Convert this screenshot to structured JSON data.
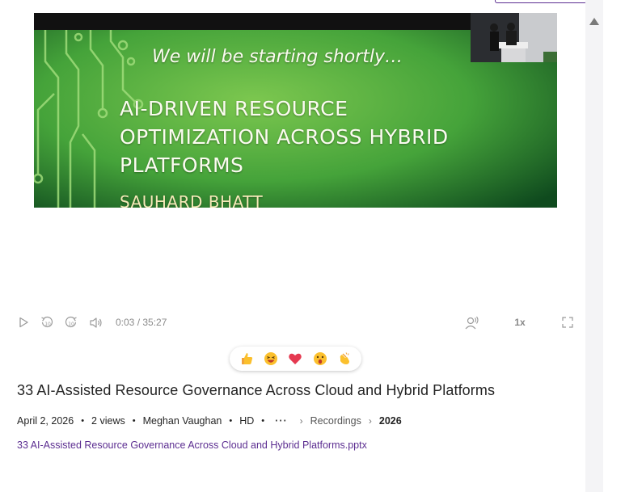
{
  "video": {
    "slide_starting": "We will be starting shortly…",
    "slide_title_lines": [
      "AI-DRIVEN RESOURCE",
      "OPTIMIZATION ACROSS HYBRID",
      "PLATFORMS"
    ],
    "slide_speaker": "SAUHARD BHATT"
  },
  "player": {
    "time_display": "0:03 / 35:27",
    "speed": "1x"
  },
  "reactions": [
    "like",
    "laugh",
    "heart",
    "surprised",
    "applause"
  ],
  "recording": {
    "title": "33 AI-Assisted Resource Governance Across Cloud and Hybrid Platforms",
    "date": "April 2, 2026",
    "views": "2 views",
    "author": "Meghan Vaughan",
    "quality": "HD",
    "more": "···",
    "breadcrumb_folder": "Recordings",
    "breadcrumb_current": "2026",
    "attachment": "33 AI-Assisted Resource Governance Across Cloud and Hybrid Platforms.pptx"
  },
  "colors": {
    "slide_green": "#4fa83c",
    "link_purple": "#5c2e91",
    "control_gray": "#9a9a9a"
  }
}
